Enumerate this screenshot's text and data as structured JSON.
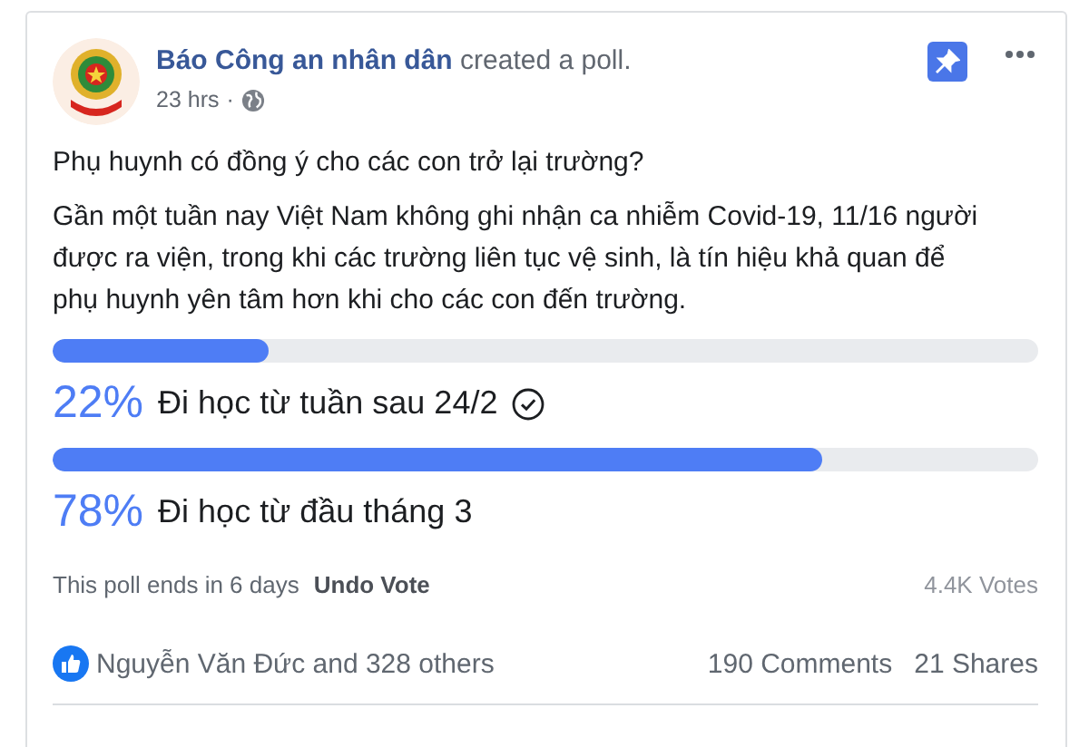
{
  "post": {
    "author": "Báo Công an nhân dân",
    "action": "created a poll.",
    "time": "23 hrs",
    "separator": "·",
    "pinned": true
  },
  "question": "Phụ huynh có đồng ý cho các con trở lại trường?",
  "description": "Gần một tuần nay Việt Nam không ghi nhận ca nhiễm Covid-19, 11/16 người được ra viện, trong khi các trường liên tục vệ sinh, là tín hiệu khả quan để phụ huynh yên tâm hơn khi cho các con đến trường.",
  "options": [
    {
      "percent": "22%",
      "label": "Đi học từ tuần sau 24/2",
      "level": 0.22,
      "selected": true
    },
    {
      "percent": "78%",
      "label": "Đi học từ đầu tháng 3",
      "level": 0.78,
      "selected": false
    }
  ],
  "poll_footer": {
    "ends": "This poll ends in 6 days",
    "undo": "Undo Vote",
    "votes": "4.4K Votes"
  },
  "reactions": {
    "likes": "Nguyễn Văn Đức and 328 others",
    "comments": "190 Comments",
    "shares": "21 Shares"
  }
}
